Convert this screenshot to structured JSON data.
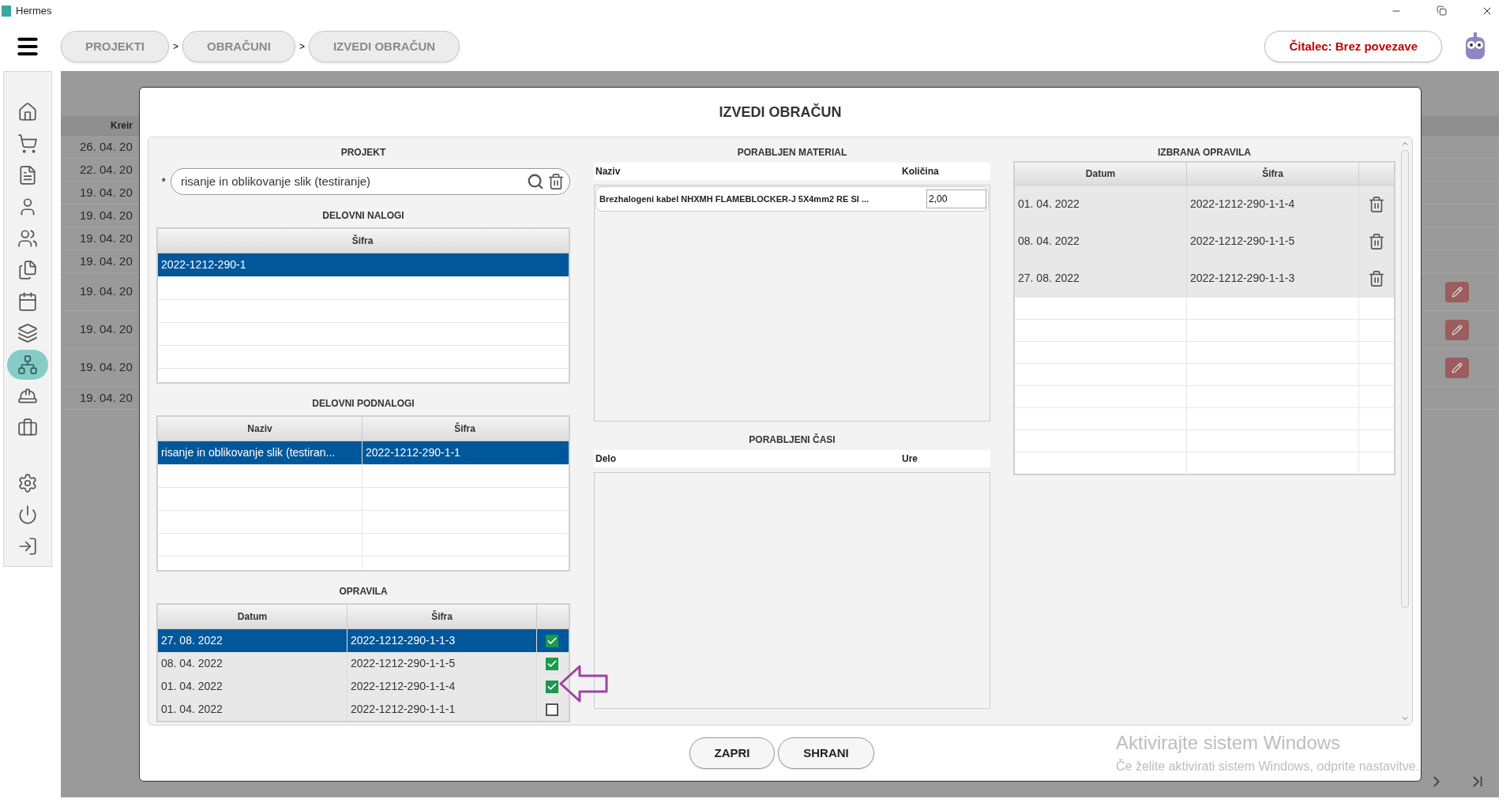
{
  "window": {
    "title": "Hermes"
  },
  "breadcrumbs": [
    "PROJEKTI",
    "OBRAČUNI",
    "IZVEDI OBRAČUN"
  ],
  "breadcrumb_separator": ">",
  "reader_button": "Čitalec: Brez povezave",
  "sidebar": {
    "items": [
      {
        "kind": "home",
        "selected": false
      },
      {
        "kind": "cart",
        "selected": false
      },
      {
        "kind": "document",
        "selected": false
      },
      {
        "kind": "user",
        "selected": false
      },
      {
        "kind": "users",
        "selected": false
      },
      {
        "kind": "files",
        "selected": false
      },
      {
        "kind": "calendar",
        "selected": false
      },
      {
        "kind": "layers",
        "selected": false
      },
      {
        "kind": "network",
        "selected": true
      },
      {
        "kind": "worker",
        "selected": false
      },
      {
        "kind": "briefcase",
        "selected": false
      }
    ],
    "bottom_items": [
      {
        "kind": "settings"
      },
      {
        "kind": "power"
      },
      {
        "kind": "logout"
      }
    ]
  },
  "background_table": {
    "column_1": "Kreir",
    "rows": [
      {
        "date": "26. 04. 20",
        "edit": false
      },
      {
        "date": "22. 04. 20",
        "edit": false
      },
      {
        "date": "19. 04. 20",
        "edit": false
      },
      {
        "date": "19. 04. 20",
        "edit": false
      },
      {
        "date": "19. 04. 20",
        "edit": false
      },
      {
        "date": "19. 04. 20",
        "edit": false
      },
      {
        "date": "19. 04. 20",
        "edit": true
      },
      {
        "date": "19. 04. 20",
        "edit": true
      },
      {
        "date": "19. 04. 20",
        "edit": true
      },
      {
        "date": "19. 04. 20",
        "edit": false
      }
    ]
  },
  "dialog": {
    "title": "IZVEDI OBRAČUN",
    "projekt": {
      "label": "PROJEKT",
      "required": "*",
      "value": "risanje in oblikovanje slik (testiranje)"
    },
    "delovni_nalogi": {
      "title": "DELOVNI NALOGI",
      "columns": [
        "Šifra"
      ],
      "rows": [
        {
          "cells": [
            "2022-1212-290-1"
          ],
          "selected": true
        }
      ]
    },
    "delovni_podnalogi": {
      "title": "DELOVNI PODNALOGI",
      "columns": [
        "Naziv",
        "Šifra"
      ],
      "rows": [
        {
          "cells": [
            "risanje in oblikovanje slik (testiran...",
            "2022-1212-290-1-1"
          ],
          "selected": true
        }
      ]
    },
    "opravila": {
      "title": "OPRAVILA",
      "columns": [
        "Datum",
        "Šifra"
      ],
      "rows": [
        {
          "cells": [
            "27. 08. 2022",
            "2022-1212-290-1-1-3"
          ],
          "selected": true,
          "checked": true
        },
        {
          "cells": [
            "08. 04. 2022",
            "2022-1212-290-1-1-5"
          ],
          "selected": false,
          "checked": true
        },
        {
          "cells": [
            "01. 04. 2022",
            "2022-1212-290-1-1-4"
          ],
          "selected": false,
          "checked": true
        },
        {
          "cells": [
            "01. 04. 2022",
            "2022-1212-290-1-1-1"
          ],
          "selected": false,
          "checked": false
        }
      ]
    },
    "porabljen_material": {
      "title": "PORABLJEN MATERIAL",
      "columns": [
        "Naziv",
        "Količina"
      ],
      "items": [
        {
          "name": "Brezhalogeni kabel NHXMH FLAMEBLOCKER-J 5X4mm2 RE SI ...",
          "quantity": "2,00"
        }
      ]
    },
    "porabljeni_casi": {
      "title": "PORABLJENI ČASI",
      "columns": [
        "Delo",
        "Ure"
      ]
    },
    "izbrana_opravila": {
      "title": "IZBRANA OPRAVILA",
      "columns": [
        "Datum",
        "Šifra"
      ],
      "rows": [
        {
          "cells": [
            "01. 04. 2022",
            "2022-1212-290-1-1-4"
          ]
        },
        {
          "cells": [
            "08. 04. 2022",
            "2022-1212-290-1-1-5"
          ]
        },
        {
          "cells": [
            "27. 08. 2022",
            "2022-1212-290-1-1-3"
          ]
        }
      ]
    },
    "buttons": [
      "ZAPRI",
      "SHRANI"
    ]
  },
  "windows_notice": {
    "title": "Aktivirajte sistem Windows",
    "text": "Če želite aktivirati sistem Windows, odprite nastavitve."
  }
}
